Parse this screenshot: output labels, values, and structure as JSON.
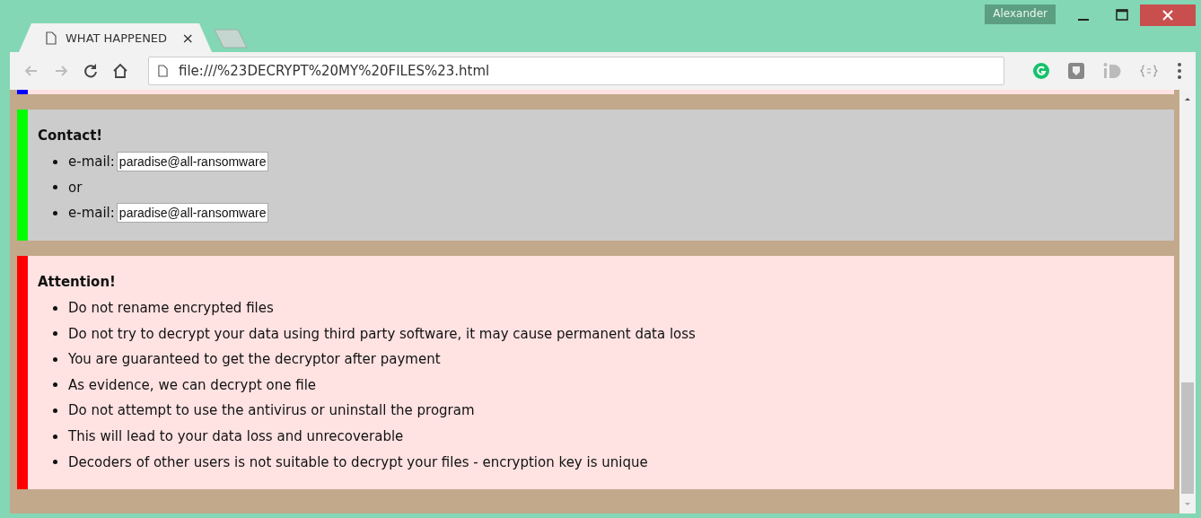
{
  "window": {
    "user": "Alexander"
  },
  "tabs": [
    {
      "title": "WHAT HAPPENED",
      "close": "×",
      "selected": true
    }
  ],
  "address_bar": {
    "url": "file:///%23DECRYPT%20MY%20FILES%23.html"
  },
  "sections": [
    {
      "kind": "notice",
      "color": "#0000ff"
    },
    {
      "kind": "contact",
      "color": "#00ff00",
      "title": "Contact!",
      "items": [
        {
          "kind": "email",
          "label": "e-mail:",
          "value": "paradise@all-ransomware"
        },
        {
          "kind": "text",
          "text": "or"
        },
        {
          "kind": "email",
          "label": "e-mail:",
          "value": "paradise@all-ransomware"
        }
      ]
    },
    {
      "kind": "notice",
      "color": "#ff0000",
      "title": "Attention!",
      "items": [
        {
          "kind": "text",
          "text": "Do not rename encrypted files"
        },
        {
          "kind": "text",
          "text": "Do not try to decrypt your data using third party software, it may cause permanent data loss"
        },
        {
          "kind": "text",
          "text": "You are guaranteed to get the decryptor after payment"
        },
        {
          "kind": "text",
          "text": "As evidence, we can decrypt one file"
        },
        {
          "kind": "text",
          "text": "Do not attempt to use the antivirus or uninstall the program"
        },
        {
          "kind": "text",
          "text": "This will lead to your data loss and unrecoverable"
        },
        {
          "kind": "text",
          "text": "Decoders of other users is not suitable to decrypt your files - encryption key is unique"
        }
      ]
    }
  ]
}
